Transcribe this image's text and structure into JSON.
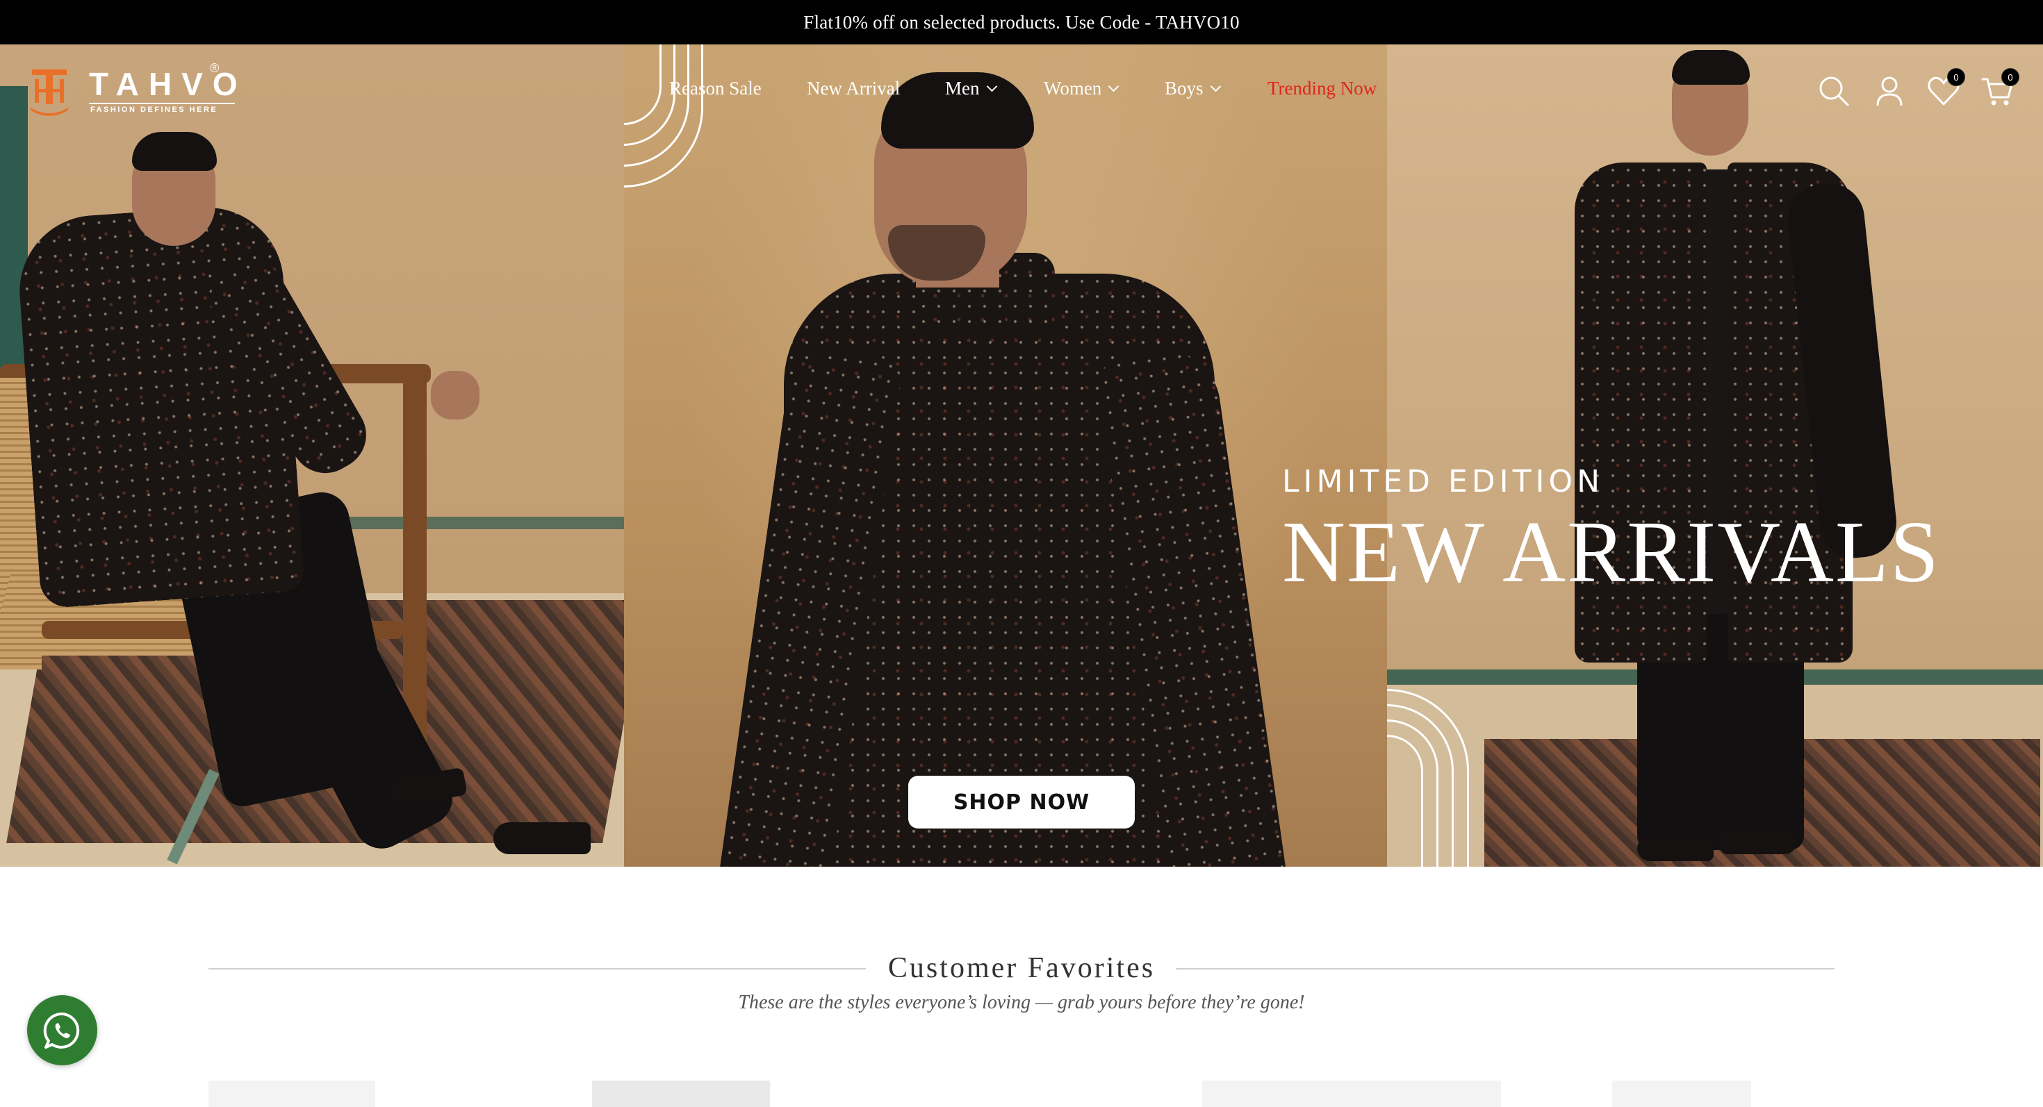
{
  "announcement": {
    "text": "Flat10% off on selected products. Use Code - TAHVO10"
  },
  "brand": {
    "name": "TAHVO",
    "registered_mark": "®",
    "tagline": "FASHION DEFINES HERE",
    "logo_color": "#e8702a"
  },
  "nav": {
    "items": [
      {
        "label": "Reason Sale",
        "has_dropdown": false
      },
      {
        "label": "New Arrival",
        "has_dropdown": false
      },
      {
        "label": "Men",
        "has_dropdown": true
      },
      {
        "label": "Women",
        "has_dropdown": true
      },
      {
        "label": "Boys",
        "has_dropdown": true
      },
      {
        "label": "Trending Now",
        "has_dropdown": false,
        "color": "#e0251b"
      }
    ]
  },
  "header_icons": {
    "search": "search-icon",
    "account": "user-icon",
    "wishlist": {
      "icon": "heart-icon",
      "count": "0"
    },
    "cart": {
      "icon": "cart-icon",
      "count": "0"
    }
  },
  "hero": {
    "kicker": "LIMITED EDITION",
    "title": "NEW ARRIVALS",
    "cta": "SHOP NOW"
  },
  "section": {
    "title": "Customer Favorites",
    "subtitle": "These are the styles everyone’s loving — grab yours before they’re gone!"
  },
  "floating": {
    "whatsapp": "whatsapp-icon",
    "whatsapp_color": "#2f7d31"
  }
}
